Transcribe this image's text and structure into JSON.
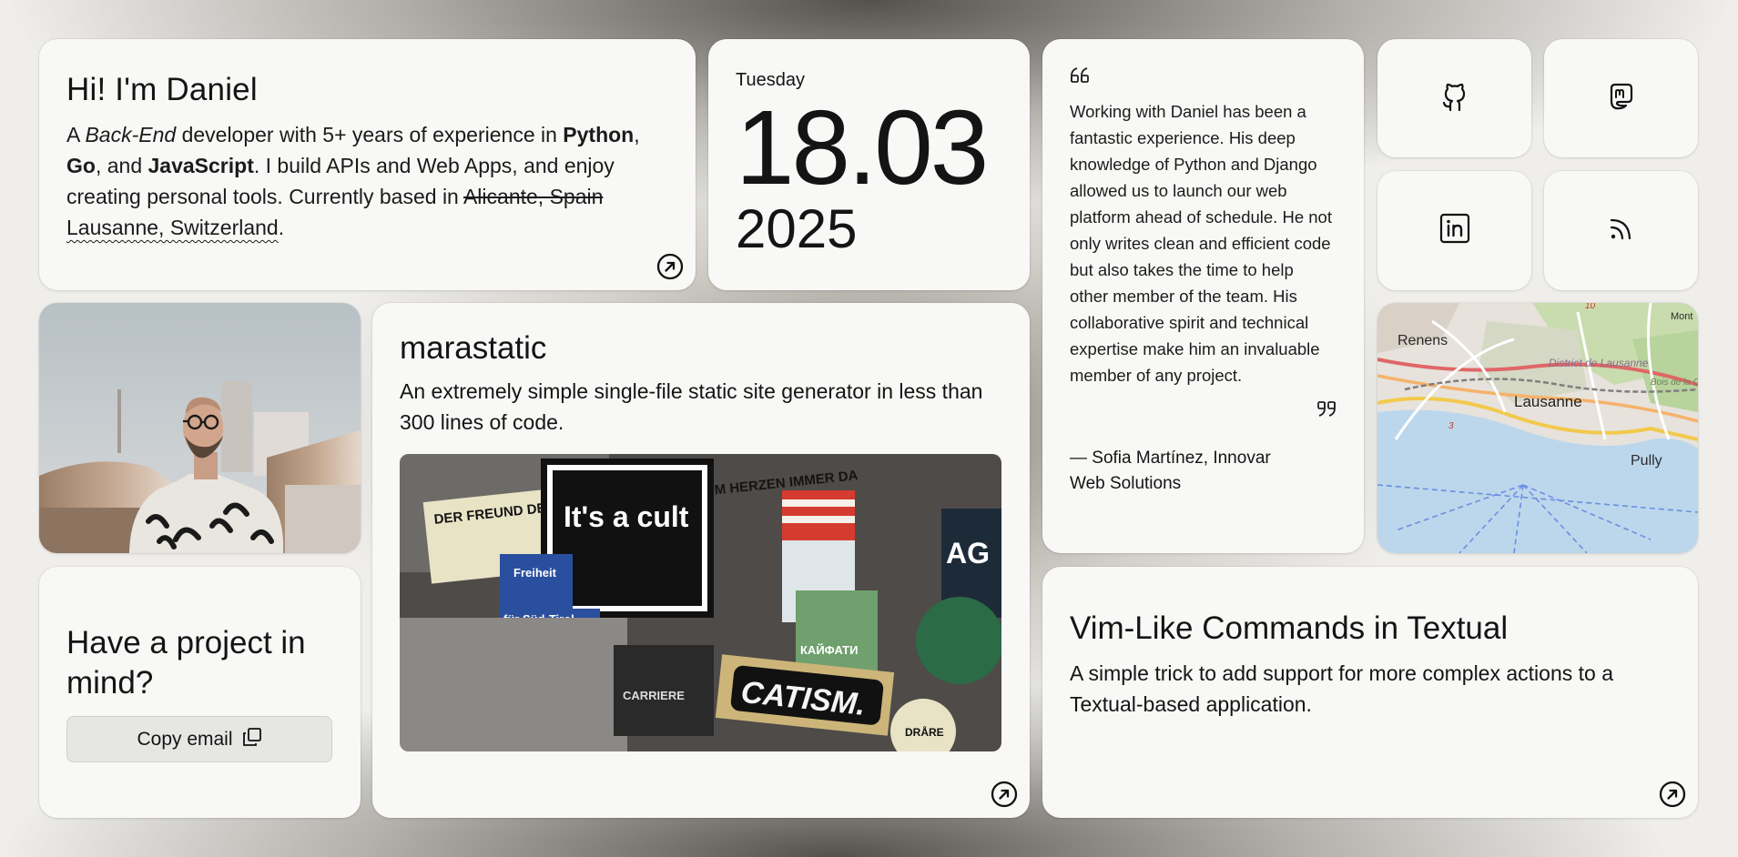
{
  "intro": {
    "title": "Hi! I'm Daniel",
    "text_a": "A ",
    "text_b": "Back-End",
    "text_c": " developer with 5+ years of experience in ",
    "lang1": "Python",
    "sep1": ", ",
    "lang2": "Go",
    "sep2": ", and ",
    "lang3": "JavaScript",
    "text_d": ". I build APIs and Web Apps, and enjoy creating personal tools. Currently based in ",
    "old_location": "Alicante, Spain",
    "space": " ",
    "new_location": "Lausanne, Switzerland",
    "period": "."
  },
  "date": {
    "weekday": "Tuesday",
    "day_month": "18.03",
    "year": "2025"
  },
  "testimonial": {
    "text": "Working with Daniel has been a fantastic experience. His deep knowledge of Python and Django allowed us to launch our web platform ahead of schedule. He not only writes clean and efficient code but also takes the time to help other member of the team. His collaborative spirit and technical expertise make him an invaluable member of any project.",
    "author_line1": "— Sofia Martínez, Innovar",
    "author_line2": "Web Solutions"
  },
  "socials": [
    {
      "icon": "github-icon"
    },
    {
      "icon": "mastodon-icon"
    },
    {
      "icon": "linkedin-icon"
    },
    {
      "icon": "rss-icon"
    }
  ],
  "map": {
    "labels": [
      "Renens",
      "District de Lausanne",
      "Lausanne",
      "Pully",
      "Bois de la Chenaie",
      "Mont",
      "10",
      "3"
    ]
  },
  "project": {
    "title": "marastatic",
    "description": "An extremely simple single-file static site generator in less than 300 lines of code.",
    "collage_text": [
      "DER FREUND DER NEBEN MIR FEHLT IST IM HERZEN IMMER DA",
      "It's a cult",
      "Freiheit",
      "für Süd-Tirol",
      "CATISM.",
      "AG",
      "DRÅRE",
      "КАЙФАТИ",
      "CARRIERE"
    ]
  },
  "contact": {
    "title": "Have a project in mind?",
    "button_label": "Copy email"
  },
  "post": {
    "title": "Vim-Like Commands in Textual",
    "description": "A simple trick to add support for more complex actions to a Textual-based application."
  },
  "colors": {
    "card": "#f8f8f6",
    "text": "#141414",
    "water": "#bcd7ec",
    "button": "#e6e6e4"
  }
}
